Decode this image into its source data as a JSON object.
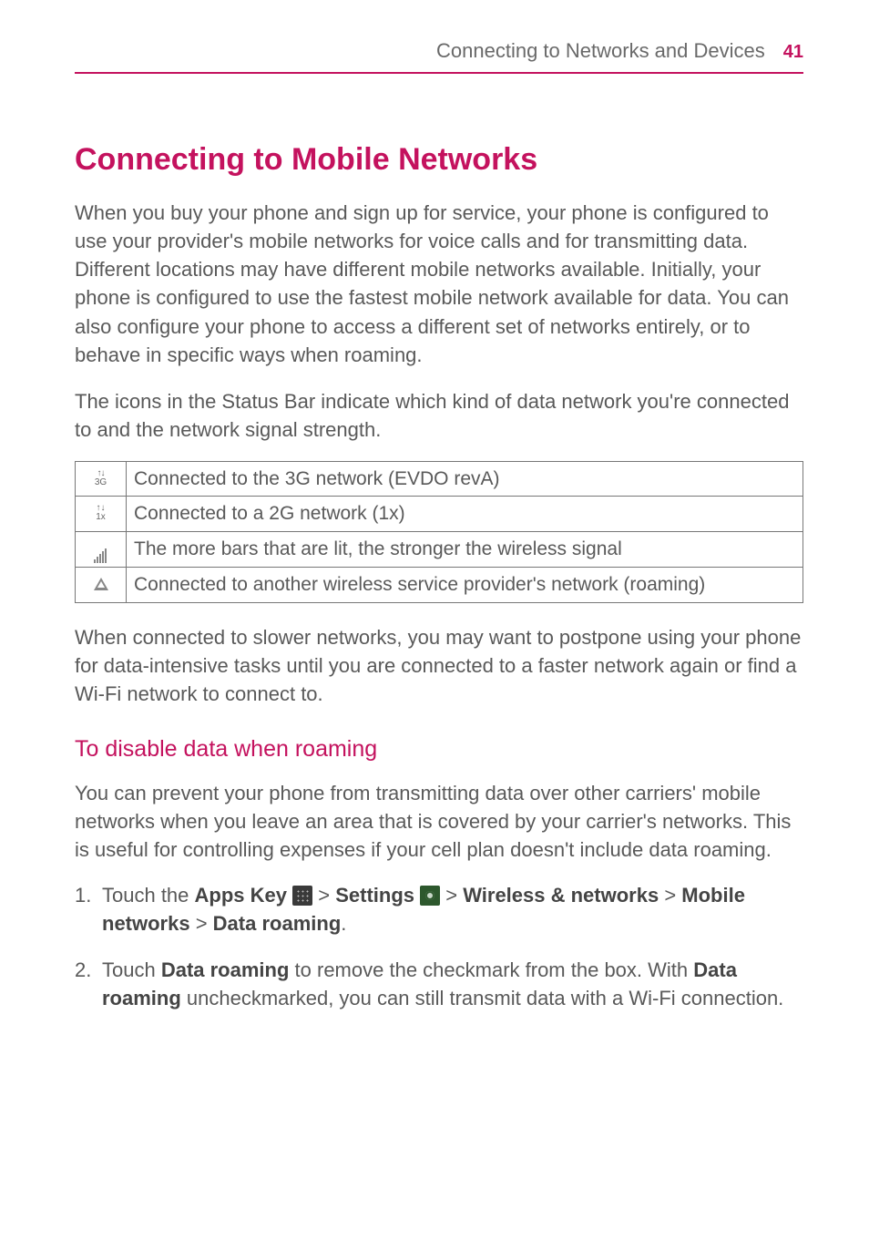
{
  "running_head": {
    "title": "Connecting to Networks and Devices",
    "page_number": "41"
  },
  "section_title": "Connecting to Mobile Networks",
  "intro_para_1": "When you buy your phone and sign up for service, your phone is configured to use your provider's mobile networks for voice calls and for transmitting data.",
  "intro_para_2": "Different locations may have different mobile networks available. Initially, your phone is configured to use the fastest mobile network available for data. You can also configure your phone to access a different set of networks entirely, or to behave in specific ways when roaming.",
  "intro_para_3": "The icons in the Status Bar indicate which kind of data network you're connected to and the network signal strength.",
  "status_icons": [
    {
      "icon": "3g",
      "desc": "Connected to the 3G network (EVDO revA)"
    },
    {
      "icon": "1x",
      "desc": "Connected to a 2G network (1x)"
    },
    {
      "icon": "bars",
      "desc": "The more bars that are lit, the stronger the wireless signal"
    },
    {
      "icon": "triangle",
      "desc": "Connected to another wireless service provider's network (roaming)"
    }
  ],
  "after_table_para": "When connected to slower networks, you may want to postpone using your phone for data-intensive tasks until you are connected to a faster network again or find a Wi-Fi network to connect to.",
  "subheading": "To disable data when roaming",
  "sub_para": "You can prevent your phone from transmitting data over other carriers' mobile networks when you leave an area that is covered by your carrier's networks. This is useful for controlling expenses if your cell plan doesn't include data roaming.",
  "steps": {
    "s1_prefix": "Touch the ",
    "s1_apps": "Apps Key",
    "s1_gt1": " > ",
    "s1_settings": "Settings",
    "s1_gt2": " > ",
    "s1_wireless": "Wireless & networks",
    "s1_gt3": " > ",
    "s1_mobile": "Mobile networks",
    "s1_gt4": " > ",
    "s1_data": "Data roaming",
    "s1_period": ".",
    "s2_prefix": "Touch ",
    "s2_bold1": "Data roaming",
    "s2_mid": " to remove the checkmark from the box. With ",
    "s2_bold2": "Data roaming",
    "s2_suffix": " uncheckmarked, you can still transmit data with a Wi-Fi connection."
  }
}
